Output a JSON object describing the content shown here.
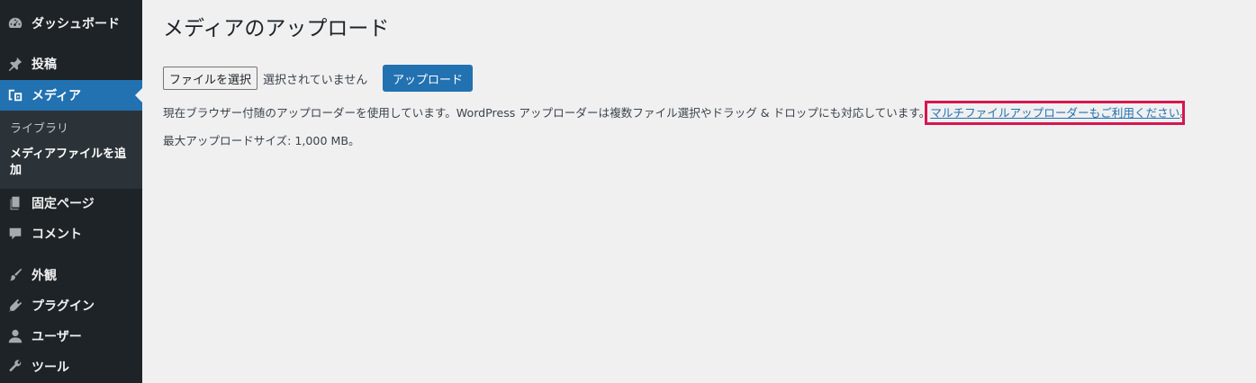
{
  "sidebar": {
    "items": [
      {
        "label": "ダッシュボード",
        "icon": "dashboard-icon"
      },
      {
        "label": "投稿",
        "icon": "pushpin-icon"
      },
      {
        "label": "メディア",
        "icon": "media-icon"
      },
      {
        "label": "固定ページ",
        "icon": "pages-icon"
      },
      {
        "label": "コメント",
        "icon": "comment-icon"
      },
      {
        "label": "外観",
        "icon": "paintbrush-icon"
      },
      {
        "label": "プラグイン",
        "icon": "plugin-icon"
      },
      {
        "label": "ユーザー",
        "icon": "user-icon"
      },
      {
        "label": "ツール",
        "icon": "wrench-icon"
      }
    ],
    "media_submenu": {
      "library": "ライブラリ",
      "add_new": "メディアファイルを追加"
    }
  },
  "main": {
    "title": "メディアのアップロード",
    "file_button": "ファイルを選択",
    "no_file": "選択されていません",
    "upload_button": "アップロード",
    "info_text": "現在ブラウザー付随のアップローダーを使用しています。WordPress アップローダーは複数ファイル選択やドラッグ & ドロップにも対応しています。",
    "multi_link": "マルチファイルアップローダーもご利用ください",
    "info_suffix": "。",
    "max_size": "最大アップロードサイズ: 1,000 MB。"
  },
  "colors": {
    "sidebar_bg": "#1d2327",
    "accent": "#2271b1",
    "highlight": "#d5174f"
  }
}
